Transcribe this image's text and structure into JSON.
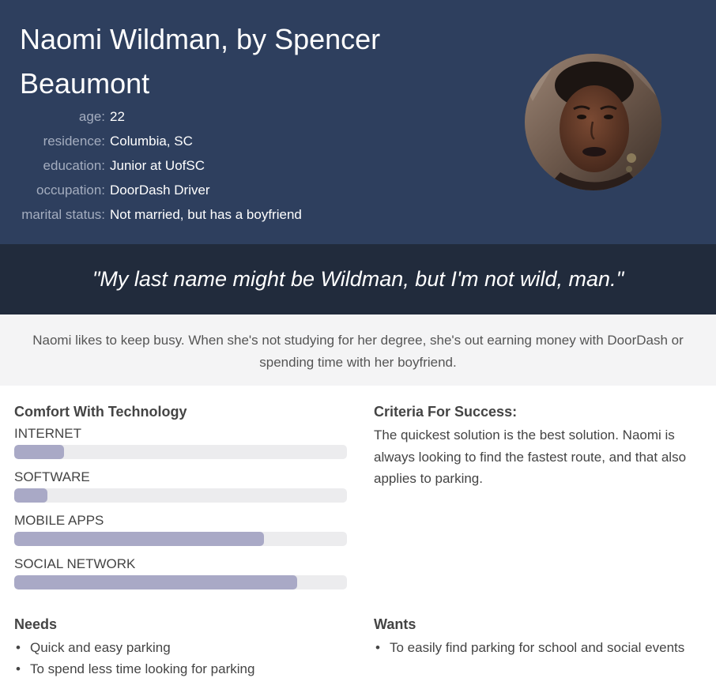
{
  "persona": {
    "title": "Naomi Wildman, by Spencer Beaumont",
    "facts": [
      {
        "label": "age:",
        "value": "22"
      },
      {
        "label": "residence:",
        "value": "Columbia, SC"
      },
      {
        "label": "education:",
        "value": "Junior at UofSC"
      },
      {
        "label": "occupation:",
        "value": "DoorDash Driver"
      },
      {
        "label": "marital status:",
        "value": "Not married, but has a boyfriend"
      }
    ]
  },
  "quote": "\"My last name might be Wildman, but I'm not wild, man.\"",
  "summary": "Naomi likes to keep busy. When she's not studying for her degree, she's out earning money with DoorDash or spending time with her boyfriend.",
  "technology": {
    "heading": "Comfort With Technology",
    "skills": [
      {
        "label": "INTERNET",
        "level": 0.15
      },
      {
        "label": "SOFTWARE",
        "level": 0.1
      },
      {
        "label": "MOBILE APPS",
        "level": 0.75
      },
      {
        "label": "SOCIAL NETWORK",
        "level": 0.85
      }
    ]
  },
  "criteria": {
    "heading": "Criteria For Success:",
    "text": "The quickest solution is the best solution. Naomi is always looking to find the fastest route, and that also applies to parking."
  },
  "needs": {
    "heading": "Needs",
    "items": [
      "Quick and easy parking",
      "To spend less time looking for parking"
    ]
  },
  "wants": {
    "heading": "Wants",
    "items": [
      "To easily find parking for school and social events"
    ]
  }
}
